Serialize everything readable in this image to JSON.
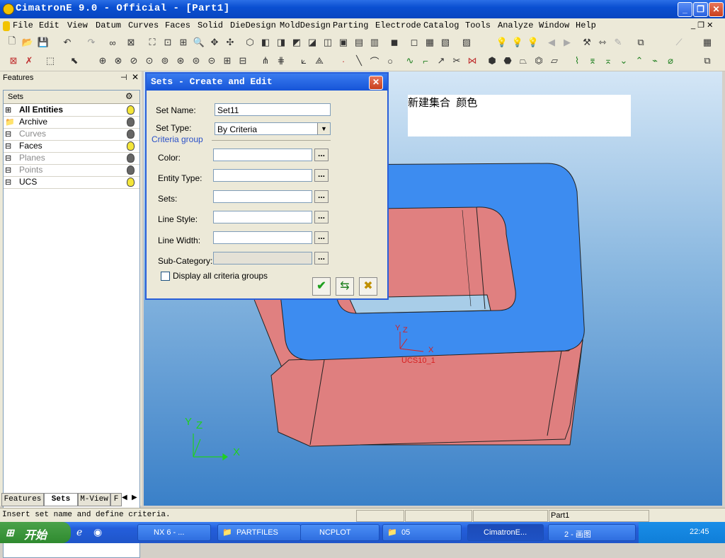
{
  "window": {
    "title": "CimatronE 9.0 - Official - [Part1]"
  },
  "menu": [
    "File",
    "Edit",
    "View",
    "Datum",
    "Curves",
    "Faces",
    "Solid",
    "DieDesign",
    "MoldDesign",
    "Parting",
    "Electrode",
    "Catalog",
    "Tools",
    "Analyze",
    "Window",
    "Help"
  ],
  "features_panel": {
    "title": "Features",
    "header": "Sets",
    "items": [
      {
        "label": "All Entities",
        "bold": true,
        "bulb": "on"
      },
      {
        "label": "Archive",
        "bulb": "off"
      },
      {
        "label": "Curves",
        "grey": true,
        "bulb": "off"
      },
      {
        "label": "Faces",
        "bulb": "on"
      },
      {
        "label": "Planes",
        "grey": true,
        "bulb": "off"
      },
      {
        "label": "Points",
        "grey": true,
        "bulb": "off"
      },
      {
        "label": "UCS",
        "bulb": "on"
      }
    ],
    "tabs": [
      "Features",
      "Sets",
      "M-View",
      "F"
    ]
  },
  "dialog": {
    "title": "Sets - Create and Edit",
    "set_name_label": "Set Name:",
    "set_name_value": "Set11",
    "set_type_label": "Set Type:",
    "set_type_value": "By Criteria",
    "criteria_group_label": "Criteria group",
    "color_label": "Color:",
    "entity_type_label": "Entity Type:",
    "sets_label": "Sets:",
    "line_style_label": "Line Style:",
    "line_width_label": "Line Width:",
    "sub_category_label": "Sub-Category:",
    "display_all_label": "Display all criteria groups",
    "dots": "..."
  },
  "annotation": {
    "text": "新建集合  颜色"
  },
  "viewport": {
    "ucs_label": "UCS10_1",
    "axis_y": "Y",
    "axis_z": "Z",
    "axis_x": "X",
    "part_color": "#e08080",
    "top_color": "#3d8cf0"
  },
  "status": {
    "message": "Insert set name and define criteria.",
    "part": "Part1"
  },
  "taskbar": {
    "start": "开始",
    "tasks": [
      "NX 6 - ...",
      "PARTFILES",
      "NCPLOT",
      "05",
      "CimatronE...",
      "2 - 画图"
    ],
    "time": "22:45"
  }
}
